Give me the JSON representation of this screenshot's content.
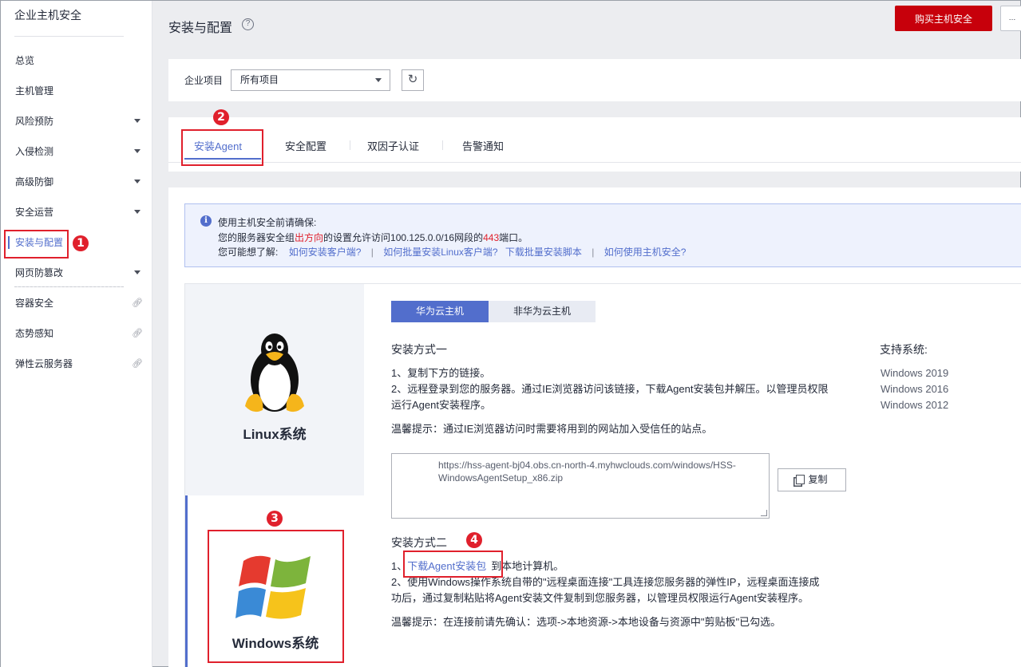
{
  "sidebar": {
    "title": "企业主机安全",
    "items": [
      {
        "label": "总览"
      },
      {
        "label": "主机管理"
      },
      {
        "label": "风险预防"
      },
      {
        "label": "入侵检测"
      },
      {
        "label": "高级防御"
      },
      {
        "label": "安全运营"
      },
      {
        "label": "安装与配置"
      },
      {
        "label": "网页防篡改"
      },
      {
        "label": "容器安全"
      },
      {
        "label": "态势感知"
      },
      {
        "label": "弹性云服务器"
      }
    ],
    "link_icon": "external-link-icon"
  },
  "badges": [
    "1",
    "2",
    "3",
    "4"
  ],
  "header": {
    "title": "安装与配置",
    "help_icon": "?",
    "buy_label": "购买主机安全",
    "more_label": "…"
  },
  "project": {
    "label": "企业项目",
    "selected": "所有项目",
    "refresh_icon": "↻"
  },
  "tabs": [
    {
      "label": "安装Agent"
    },
    {
      "label": "安全配置"
    },
    {
      "label": "双因子认证"
    },
    {
      "label": "告警通知"
    }
  ],
  "notice": {
    "icon": "i",
    "line1": "使用主机安全前请确保:",
    "line2_a": "您的服务器安全组",
    "line2_b": "出方向",
    "line2_c": "的设置允许访问100.125.0.0/16网段的",
    "line2_d": "443",
    "line2_e": "端口。",
    "line3_label": "您可能想了解:",
    "links": [
      "如何安装客户端?",
      "如何批量安装Linux客户端?",
      "下载批量安装脚本",
      "如何使用主机安全?"
    ],
    "sep": "|"
  },
  "os": {
    "linux": "Linux系统",
    "windows": "Windows系统"
  },
  "segments": {
    "huawei": "华为云主机",
    "non_huawei": "非华为云主机"
  },
  "method1": {
    "title": "安装方式一",
    "step1": "1、复制下方的链接。",
    "step2a": "2、远程登录到您的服务器。通过IE浏览器访问该链接，下载Agent安装包并解压。以管理员权限",
    "step2b": "运行Agent安装程序。",
    "tip": "温馨提示：通过IE浏览器访问时需要将用到的网站加入受信任的站点。",
    "url_line1": "https://hss-agent-bj04.obs.cn-north-4.myhwclouds.com/windows/HSS-",
    "url_line2": "WindowsAgentSetup_x86.zip",
    "copy_label": "复制"
  },
  "support": {
    "title": "支持系统:",
    "systems": [
      "Windows 2019",
      "Windows 2016",
      "Windows 2012"
    ]
  },
  "method2": {
    "title": "安装方式二",
    "step1_prefix": "1、",
    "step1_link": "下载Agent安装包",
    "step1_suffix": "到本地计算机。",
    "step2a": "2、使用Windows操作系统自带的\"远程桌面连接\"工具连接您服务器的弹性IP，远程桌面连接成",
    "step2b": "功后，通过复制粘贴将Agent安装文件复制到您服务器，以管理员权限运行Agent安装程序。",
    "tip": "温馨提示：在连接前请先确认：选项->本地资源->本地设备与资源中\"剪贴板\"已勾选。"
  },
  "colors": {
    "accent": "#526ecc",
    "brand_red": "#c7000b",
    "annotation_red": "#e0202c"
  }
}
